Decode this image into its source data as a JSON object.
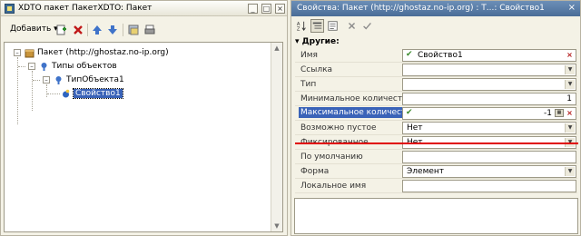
{
  "left": {
    "title": "XDTO пакет ПакетXDTO: Пакет",
    "toolbar": {
      "add_label": "Добавить"
    },
    "tree": {
      "root": "Пакет (http://ghostaz.no-ip.org)",
      "types": "Типы объектов",
      "type1": "ТипОбъекта1",
      "prop1": "Свойство1"
    }
  },
  "right": {
    "title": "Свойства: Пакет (http://ghostaz.no-ip.org) : Т...: Свойство1",
    "group": "Другие:",
    "rows": [
      {
        "label": "Имя",
        "value": "Свойство1",
        "check": true
      },
      {
        "label": "Ссылка",
        "value": ""
      },
      {
        "label": "Тип",
        "value": ""
      },
      {
        "label": "Минимальное количество",
        "value": "1"
      },
      {
        "label": "Максимальное количество",
        "value": "-1",
        "check": true
      },
      {
        "label": "Возможно пустое",
        "value": "Нет"
      },
      {
        "label": "Фиксированное",
        "value": "Нет"
      },
      {
        "label": "По умолчанию",
        "value": ""
      },
      {
        "label": "Форма",
        "value": "Элемент"
      },
      {
        "label": "Локальное имя",
        "value": ""
      }
    ]
  },
  "colors": {
    "selection": "#3a63b8",
    "title_active": "#4a6d97",
    "highlight_line": "#e00000"
  }
}
